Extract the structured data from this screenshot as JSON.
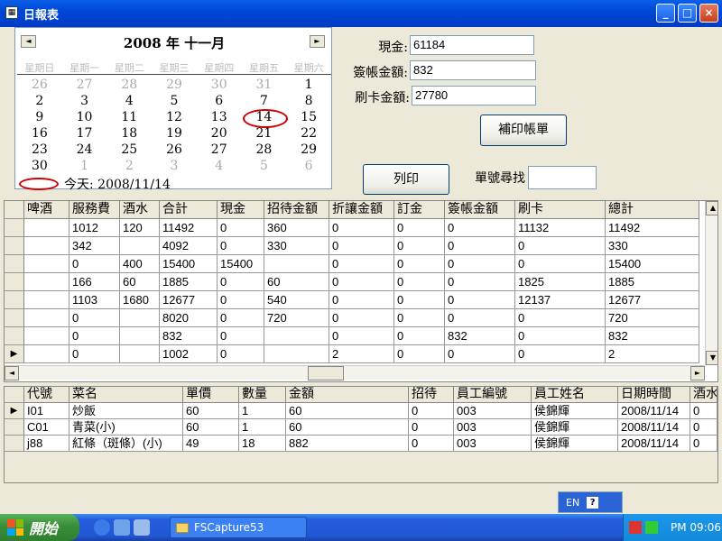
{
  "window": {
    "title": "日報表",
    "min": "_",
    "max": "□",
    "close": "×"
  },
  "calendar": {
    "title": "2008 年 十一月",
    "prev": "◄",
    "next": "►",
    "weekdays": [
      "星期日",
      "星期一",
      "星期二",
      "星期三",
      "星期四",
      "星期五",
      "星期六"
    ],
    "days": [
      [
        "26",
        0
      ],
      [
        "27",
        0
      ],
      [
        "28",
        0
      ],
      [
        "29",
        0
      ],
      [
        "30",
        0
      ],
      [
        "31",
        0
      ],
      [
        "1",
        1
      ],
      [
        "2",
        1
      ],
      [
        "3",
        1
      ],
      [
        "4",
        1
      ],
      [
        "5",
        1
      ],
      [
        "6",
        1
      ],
      [
        "7",
        1
      ],
      [
        "8",
        1
      ],
      [
        "9",
        1
      ],
      [
        "10",
        1
      ],
      [
        "11",
        1
      ],
      [
        "12",
        1
      ],
      [
        "13",
        1
      ],
      [
        "14",
        1
      ],
      [
        "15",
        1
      ],
      [
        "16",
        1
      ],
      [
        "17",
        1
      ],
      [
        "18",
        1
      ],
      [
        "19",
        1
      ],
      [
        "20",
        1
      ],
      [
        "21",
        1
      ],
      [
        "22",
        1
      ],
      [
        "23",
        1
      ],
      [
        "24",
        1
      ],
      [
        "25",
        1
      ],
      [
        "26",
        1
      ],
      [
        "27",
        1
      ],
      [
        "28",
        1
      ],
      [
        "29",
        1
      ],
      [
        "30",
        1
      ],
      [
        "1",
        0
      ],
      [
        "2",
        0
      ],
      [
        "3",
        0
      ],
      [
        "4",
        0
      ],
      [
        "5",
        0
      ],
      [
        "6",
        0
      ]
    ],
    "selected": "14",
    "today_label": "今天: 2008/11/14"
  },
  "form": {
    "cash_label": "現金:",
    "cash_value": "61184",
    "sign_label": "簽帳金額:",
    "sign_value": "832",
    "card_label": "刷卡金額:",
    "card_value": "27780",
    "reprint_button": "補印帳單",
    "print_button": "列印",
    "search_label": "單號尋找",
    "search_value": ""
  },
  "grid1": {
    "headers": [
      "",
      "啤酒",
      "服務費",
      "酒水",
      "合計",
      "現金",
      "招待金額",
      "折讓金額",
      "訂金",
      "簽帳金額",
      "刷卡",
      "總計"
    ],
    "rows": [
      [
        "",
        "",
        "1012",
        "120",
        "11492",
        "0",
        "360",
        "0",
        "0",
        "0",
        "11132",
        "11492"
      ],
      [
        "",
        "",
        "342",
        "",
        "4092",
        "0",
        "330",
        "0",
        "0",
        "0",
        "0",
        "330"
      ],
      [
        "",
        "",
        "0",
        "400",
        "15400",
        "15400",
        "",
        "0",
        "0",
        "0",
        "0",
        "15400"
      ],
      [
        "",
        "",
        "166",
        "60",
        "1885",
        "0",
        "60",
        "0",
        "0",
        "0",
        "1825",
        "1885"
      ],
      [
        "",
        "",
        "1103",
        "1680",
        "12677",
        "0",
        "540",
        "0",
        "0",
        "0",
        "12137",
        "12677"
      ],
      [
        "",
        "",
        "0",
        "",
        "8020",
        "0",
        "720",
        "0",
        "0",
        "0",
        "0",
        "720"
      ],
      [
        "",
        "",
        "0",
        "",
        "832",
        "0",
        "",
        "0",
        "0",
        "832",
        "0",
        "832"
      ],
      [
        "▶",
        "",
        "0",
        "",
        "1002",
        "0",
        "",
        "2",
        "0",
        "0",
        "0",
        "2"
      ]
    ]
  },
  "grid2": {
    "headers": [
      "",
      "代號",
      "菜名",
      "單價",
      "數量",
      "金額",
      "招待",
      "員工編號",
      "員工姓名",
      "日期時間",
      "酒水"
    ],
    "rows": [
      [
        "▶",
        "I01",
        "炒飯",
        "60",
        "1",
        "60",
        "0",
        "003",
        "侯錦輝",
        "2008/11/14",
        "0"
      ],
      [
        "",
        "C01",
        "青菜(小)",
        "60",
        "1",
        "60",
        "0",
        "003",
        "侯錦輝",
        "2008/11/14",
        "0"
      ],
      [
        "",
        "j88",
        "紅條（斑條）(小)",
        "49",
        "18",
        "882",
        "0",
        "003",
        "侯錦輝",
        "2008/11/14",
        "0"
      ]
    ]
  },
  "langbar": {
    "lang": "EN",
    "help": "?"
  },
  "taskbar": {
    "start": "開始",
    "task": "FSCapture53",
    "clock": "PM 09:06"
  },
  "colors": {
    "title_blue": "#0048d8",
    "taskbar_blue": "#245edb",
    "start_green": "#3a913a",
    "highlight_red": "#cc0000"
  }
}
